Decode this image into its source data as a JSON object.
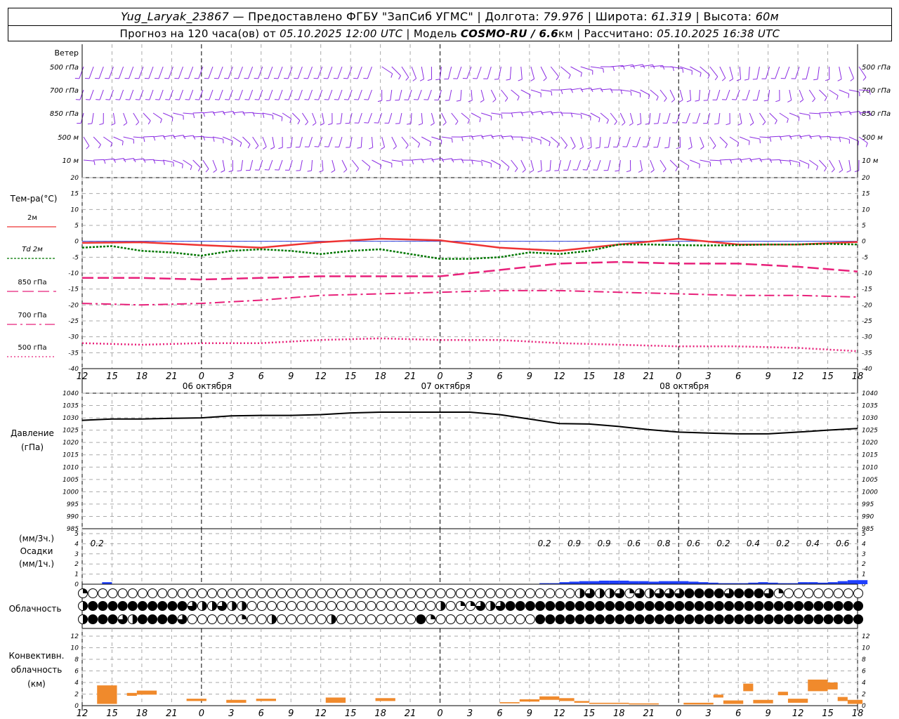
{
  "header": {
    "station": "Yug_Laryak_23867",
    "provider": " — Предоставлено ФГБУ \"ЗапСиб УГМС\" | Долгота: ",
    "lon": "79.976",
    "lat_label": " | Широта: ",
    "lat": "61.319",
    "alt_label": " | Высота: ",
    "alt": "60м",
    "forecast_label": "Прогноз на 120 часа(ов) от ",
    "forecast_start": "05.10.2025 12:00 UTC",
    "model_label": " | Модель ",
    "model": "COSMO-RU / 6.6",
    "model_unit": "км | Рассчитано: ",
    "computed": "05.10.2025 16:38 UTC"
  },
  "chart_data": {
    "type": "meteogram",
    "x_ticks": [
      "12",
      "15",
      "18",
      "21",
      "0",
      "3",
      "6",
      "9",
      "12",
      "15",
      "18",
      "21",
      "0",
      "3",
      "6",
      "9",
      "12",
      "15",
      "18",
      "21",
      "0",
      "3",
      "6",
      "9",
      "12",
      "15",
      "18"
    ],
    "day_labels": [
      {
        "hour_index": 12,
        "text": "06 октября"
      },
      {
        "hour_index": 36,
        "text": "07 октября"
      },
      {
        "hour_index": 60,
        "text": "08 октября"
      }
    ],
    "wind_panel": {
      "label": "Ветер",
      "levels_left": [
        "500 гПа",
        "700 гПа",
        "850 гПа",
        "500 м",
        "10 м"
      ],
      "levels_right": [
        "500 гПа",
        "700 гПа",
        "850 гПа",
        "500 м",
        "10 м"
      ],
      "color": "#8a2be2"
    },
    "temperature_panel": {
      "title": "Тем-ра(°С)",
      "ylim": [
        -40,
        20
      ],
      "y_ticks": [
        20,
        15,
        10,
        5,
        0,
        -5,
        -10,
        -15,
        -20,
        -25,
        -30,
        -35,
        -40
      ],
      "legend": [
        {
          "label": "2м",
          "color": "#ee3333"
        },
        {
          "label": "Td  2м",
          "color": "#007700"
        },
        {
          "label": "850 гПа",
          "color": "#e8207a"
        },
        {
          "label": "700 гПа",
          "color": "#e8207a"
        },
        {
          "label": "500 гПа",
          "color": "#e8207a"
        }
      ],
      "series": [
        {
          "key": "t2m",
          "color": "#ee3333",
          "x": [
            0,
            6,
            12,
            18,
            24,
            30,
            36,
            42,
            48,
            54,
            60,
            66,
            72,
            78
          ],
          "y": [
            -0.5,
            -0.3,
            -1.2,
            -2,
            -0.3,
            0.8,
            0.3,
            -2,
            -3,
            -1,
            0.8,
            -1,
            -1,
            -0.2
          ]
        },
        {
          "key": "td2m",
          "color": "#007700",
          "x": [
            0,
            3,
            6,
            9,
            12,
            15,
            18,
            21,
            24,
            27,
            30,
            33,
            36,
            39,
            42,
            45,
            48,
            51,
            54,
            57,
            60,
            63,
            66,
            69,
            72,
            75,
            78
          ],
          "y": [
            -2,
            -1.5,
            -3,
            -3.5,
            -4.5,
            -3,
            -2.5,
            -3,
            -4,
            -3,
            -2.5,
            -4,
            -5.5,
            -5.5,
            -5,
            -3.5,
            -4,
            -3,
            -1,
            -1,
            -1.2,
            -1.3,
            -1.2,
            -1,
            -1,
            -0.8,
            -1
          ]
        },
        {
          "key": "t850",
          "color": "#e8207a",
          "x": [
            0,
            6,
            12,
            18,
            24,
            30,
            36,
            42,
            48,
            54,
            60,
            66,
            72,
            78
          ],
          "y": [
            -11.5,
            -11.5,
            -12,
            -11.5,
            -11,
            -11,
            -11,
            -9,
            -7,
            -6.5,
            -7,
            -7,
            -8,
            -9.5
          ]
        },
        {
          "key": "t700",
          "color": "#e8207a",
          "x": [
            0,
            6,
            12,
            18,
            24,
            30,
            36,
            42,
            48,
            54,
            60,
            66,
            72,
            78
          ],
          "y": [
            -19.5,
            -20,
            -19.5,
            -18.5,
            -17,
            -16.5,
            -16,
            -15.5,
            -15.5,
            -16,
            -16.5,
            -17,
            -17,
            -17.5
          ]
        },
        {
          "key": "t500",
          "color": "#e8207a",
          "x": [
            0,
            6,
            12,
            18,
            24,
            30,
            36,
            42,
            48,
            54,
            60,
            66,
            72,
            78
          ],
          "y": [
            -32,
            -32.5,
            -32,
            -32,
            -31,
            -30.5,
            -31,
            -31,
            -32,
            -32.5,
            -33,
            -33,
            -33.5,
            -34.5
          ]
        }
      ]
    },
    "pressure_panel": {
      "title": "Давление",
      "unit": "(гПа)",
      "ylim": [
        985,
        1040
      ],
      "y_ticks": [
        1040,
        1035,
        1030,
        1025,
        1020,
        1015,
        1010,
        1005,
        1000,
        995,
        990,
        985
      ],
      "series": {
        "color": "#000000",
        "x": [
          0,
          3,
          6,
          9,
          12,
          15,
          18,
          21,
          24,
          27,
          30,
          33,
          36,
          39,
          42,
          45,
          48,
          51,
          54,
          57,
          60,
          63,
          66,
          69,
          72,
          75,
          78
        ],
        "y": [
          1029,
          1029.5,
          1029.5,
          1029.8,
          1030,
          1030.8,
          1031,
          1031,
          1031.3,
          1032,
          1032.3,
          1032.3,
          1032.3,
          1032.3,
          1031.3,
          1029.5,
          1027.7,
          1027.5,
          1026.5,
          1025.2,
          1024.2,
          1023.8,
          1023.5,
          1023.5,
          1024.2,
          1025,
          1025.7
        ]
      }
    },
    "precip_panel": {
      "label_3h": "(мм/3ч.)",
      "title": "Осадки",
      "label_1h": "(мм/1ч.)",
      "ylim": [
        0,
        5
      ],
      "y_ticks": [
        5,
        4,
        3,
        2,
        1,
        0
      ],
      "totals": [
        {
          "hour_index": 1.5,
          "text": "0.2"
        },
        {
          "hour_index": 46.5,
          "text": "0.2"
        },
        {
          "hour_index": 49.5,
          "text": "0.9"
        },
        {
          "hour_index": 52.5,
          "text": "0.9"
        },
        {
          "hour_index": 55.5,
          "text": "0.6"
        },
        {
          "hour_index": 58.5,
          "text": "0.8"
        },
        {
          "hour_index": 61.5,
          "text": "0.6"
        },
        {
          "hour_index": 64.5,
          "text": "0.2"
        },
        {
          "hour_index": 67.5,
          "text": "0.4"
        },
        {
          "hour_index": 70.5,
          "text": "0.2"
        },
        {
          "hour_index": 73.5,
          "text": "0.4"
        },
        {
          "hour_index": 76.5,
          "text": "0.6"
        }
      ],
      "hourly_mm": [
        0,
        0,
        0.2,
        0,
        0,
        0,
        0,
        0,
        0,
        0,
        0,
        0,
        0,
        0,
        0,
        0,
        0,
        0,
        0,
        0,
        0,
        0,
        0,
        0,
        0,
        0,
        0,
        0,
        0,
        0,
        0,
        0,
        0,
        0,
        0,
        0,
        0,
        0,
        0,
        0,
        0,
        0,
        0,
        0,
        0,
        0,
        0.1,
        0.1,
        0.2,
        0.25,
        0.3,
        0.3,
        0.35,
        0.35,
        0.35,
        0.3,
        0.3,
        0.25,
        0.3,
        0.3,
        0.3,
        0.25,
        0.2,
        0.15,
        0.1,
        0.1,
        0.1,
        0.15,
        0.2,
        0.15,
        0.1,
        0.1,
        0.2,
        0.2,
        0.15,
        0.2,
        0.3,
        0.4,
        0.4
      ],
      "color": "#1f3fff"
    },
    "cloud_panel": {
      "title": "Облачность",
      "rows": [
        [
          1,
          0,
          0,
          0,
          0,
          0,
          0,
          0,
          0,
          0,
          0,
          0,
          0,
          0,
          0,
          0,
          0,
          0,
          0,
          0,
          0,
          0,
          0,
          0,
          0,
          0,
          0,
          0,
          0,
          0,
          0,
          0,
          0,
          0,
          0,
          0,
          0,
          0,
          0,
          0,
          0,
          0,
          0,
          0,
          0,
          0,
          0,
          0,
          0,
          0,
          2,
          3,
          2,
          2,
          3,
          1,
          3,
          2,
          3,
          3,
          3,
          4,
          4,
          4,
          4,
          3,
          4,
          4,
          4,
          3,
          1,
          0,
          0,
          0,
          0,
          0,
          0,
          0,
          0
        ],
        [
          2,
          4,
          4,
          4,
          4,
          4,
          4,
          4,
          4,
          4,
          4,
          3,
          2,
          2,
          3,
          2,
          2,
          0,
          0,
          0,
          0,
          0,
          0,
          0,
          0,
          0,
          0,
          0,
          0,
          0,
          0,
          0,
          0,
          0,
          0,
          0,
          2,
          0,
          1,
          1,
          3,
          2,
          3,
          4,
          4,
          4,
          4,
          4,
          4,
          4,
          4,
          4,
          4,
          4,
          4,
          4,
          4,
          4,
          4,
          4,
          4,
          4,
          4,
          4,
          4,
          4,
          4,
          4,
          4,
          4,
          4,
          4,
          4,
          4,
          4,
          4,
          4,
          4,
          4
        ],
        [
          2,
          4,
          4,
          4,
          3,
          2,
          4,
          4,
          4,
          4,
          3,
          0,
          0,
          0,
          0,
          0,
          1,
          0,
          0,
          2,
          0,
          0,
          0,
          0,
          0,
          2,
          0,
          0,
          0,
          0,
          0,
          0,
          0,
          0,
          4,
          1,
          0,
          0,
          0,
          0,
          0,
          0,
          0,
          0,
          0,
          0,
          4,
          4,
          4,
          4,
          4,
          4,
          4,
          4,
          4,
          4,
          4,
          4,
          4,
          4,
          4,
          4,
          4,
          4,
          4,
          4,
          4,
          4,
          4,
          4,
          4,
          4,
          4,
          4,
          4,
          4,
          4,
          4,
          4
        ]
      ]
    },
    "convective_panel": {
      "title_line1": "Конвективн.",
      "title_line2": "облачность",
      "unit": "(км)",
      "ylim": [
        0,
        13
      ],
      "y_ticks": [
        12,
        10,
        8,
        6,
        4,
        2,
        0
      ],
      "color": "#f08a2c",
      "bars": [
        {
          "x0": 1.5,
          "x1": 3.5,
          "bottom": 0.3,
          "top": 3.5
        },
        {
          "x0": 4.5,
          "x1": 5.5,
          "bottom": 1.7,
          "top": 2.2
        },
        {
          "x0": 5.5,
          "x1": 7.5,
          "bottom": 1.9,
          "top": 2.6
        },
        {
          "x0": 10.5,
          "x1": 12.5,
          "bottom": 0.8,
          "top": 1.2
        },
        {
          "x0": 14.5,
          "x1": 16.5,
          "bottom": 0.5,
          "top": 1.0
        },
        {
          "x0": 17.5,
          "x1": 19.5,
          "bottom": 0.8,
          "top": 1.2
        },
        {
          "x0": 24.5,
          "x1": 26.5,
          "bottom": 0.5,
          "top": 1.4
        },
        {
          "x0": 29.5,
          "x1": 31.5,
          "bottom": 0.8,
          "top": 1.3
        },
        {
          "x0": 42,
          "x1": 44,
          "bottom": 0.4,
          "top": 0.6
        },
        {
          "x0": 44,
          "x1": 46,
          "bottom": 0.7,
          "top": 1.1
        },
        {
          "x0": 46,
          "x1": 48,
          "bottom": 1.0,
          "top": 1.6
        },
        {
          "x0": 48,
          "x1": 49.5,
          "bottom": 0.8,
          "top": 1.3
        },
        {
          "x0": 49.5,
          "x1": 51,
          "bottom": 0.5,
          "top": 0.8
        },
        {
          "x0": 51,
          "x1": 55,
          "bottom": 0.3,
          "top": 0.5
        },
        {
          "x0": 55,
          "x1": 58,
          "bottom": 0.2,
          "top": 0.4
        },
        {
          "x0": 60.5,
          "x1": 63.5,
          "bottom": 0.2,
          "top": 0.5
        },
        {
          "x0": 63.5,
          "x1": 64.5,
          "bottom": 1.4,
          "top": 1.9
        },
        {
          "x0": 64.5,
          "x1": 66.5,
          "bottom": 0.3,
          "top": 0.9
        },
        {
          "x0": 66.5,
          "x1": 67.5,
          "bottom": 2.5,
          "top": 3.8
        },
        {
          "x0": 67.5,
          "x1": 69.5,
          "bottom": 0.4,
          "top": 1.0
        },
        {
          "x0": 70,
          "x1": 71,
          "bottom": 1.8,
          "top": 2.4
        },
        {
          "x0": 71,
          "x1": 73,
          "bottom": 0.5,
          "top": 1.2
        },
        {
          "x0": 73,
          "x1": 75,
          "bottom": 2.5,
          "top": 4.5
        },
        {
          "x0": 75,
          "x1": 76,
          "bottom": 2.8,
          "top": 4.0
        },
        {
          "x0": 76,
          "x1": 77,
          "bottom": 0.8,
          "top": 1.5
        },
        {
          "x0": 77,
          "x1": 78.5,
          "bottom": 0.3,
          "top": 1.0
        }
      ]
    }
  }
}
